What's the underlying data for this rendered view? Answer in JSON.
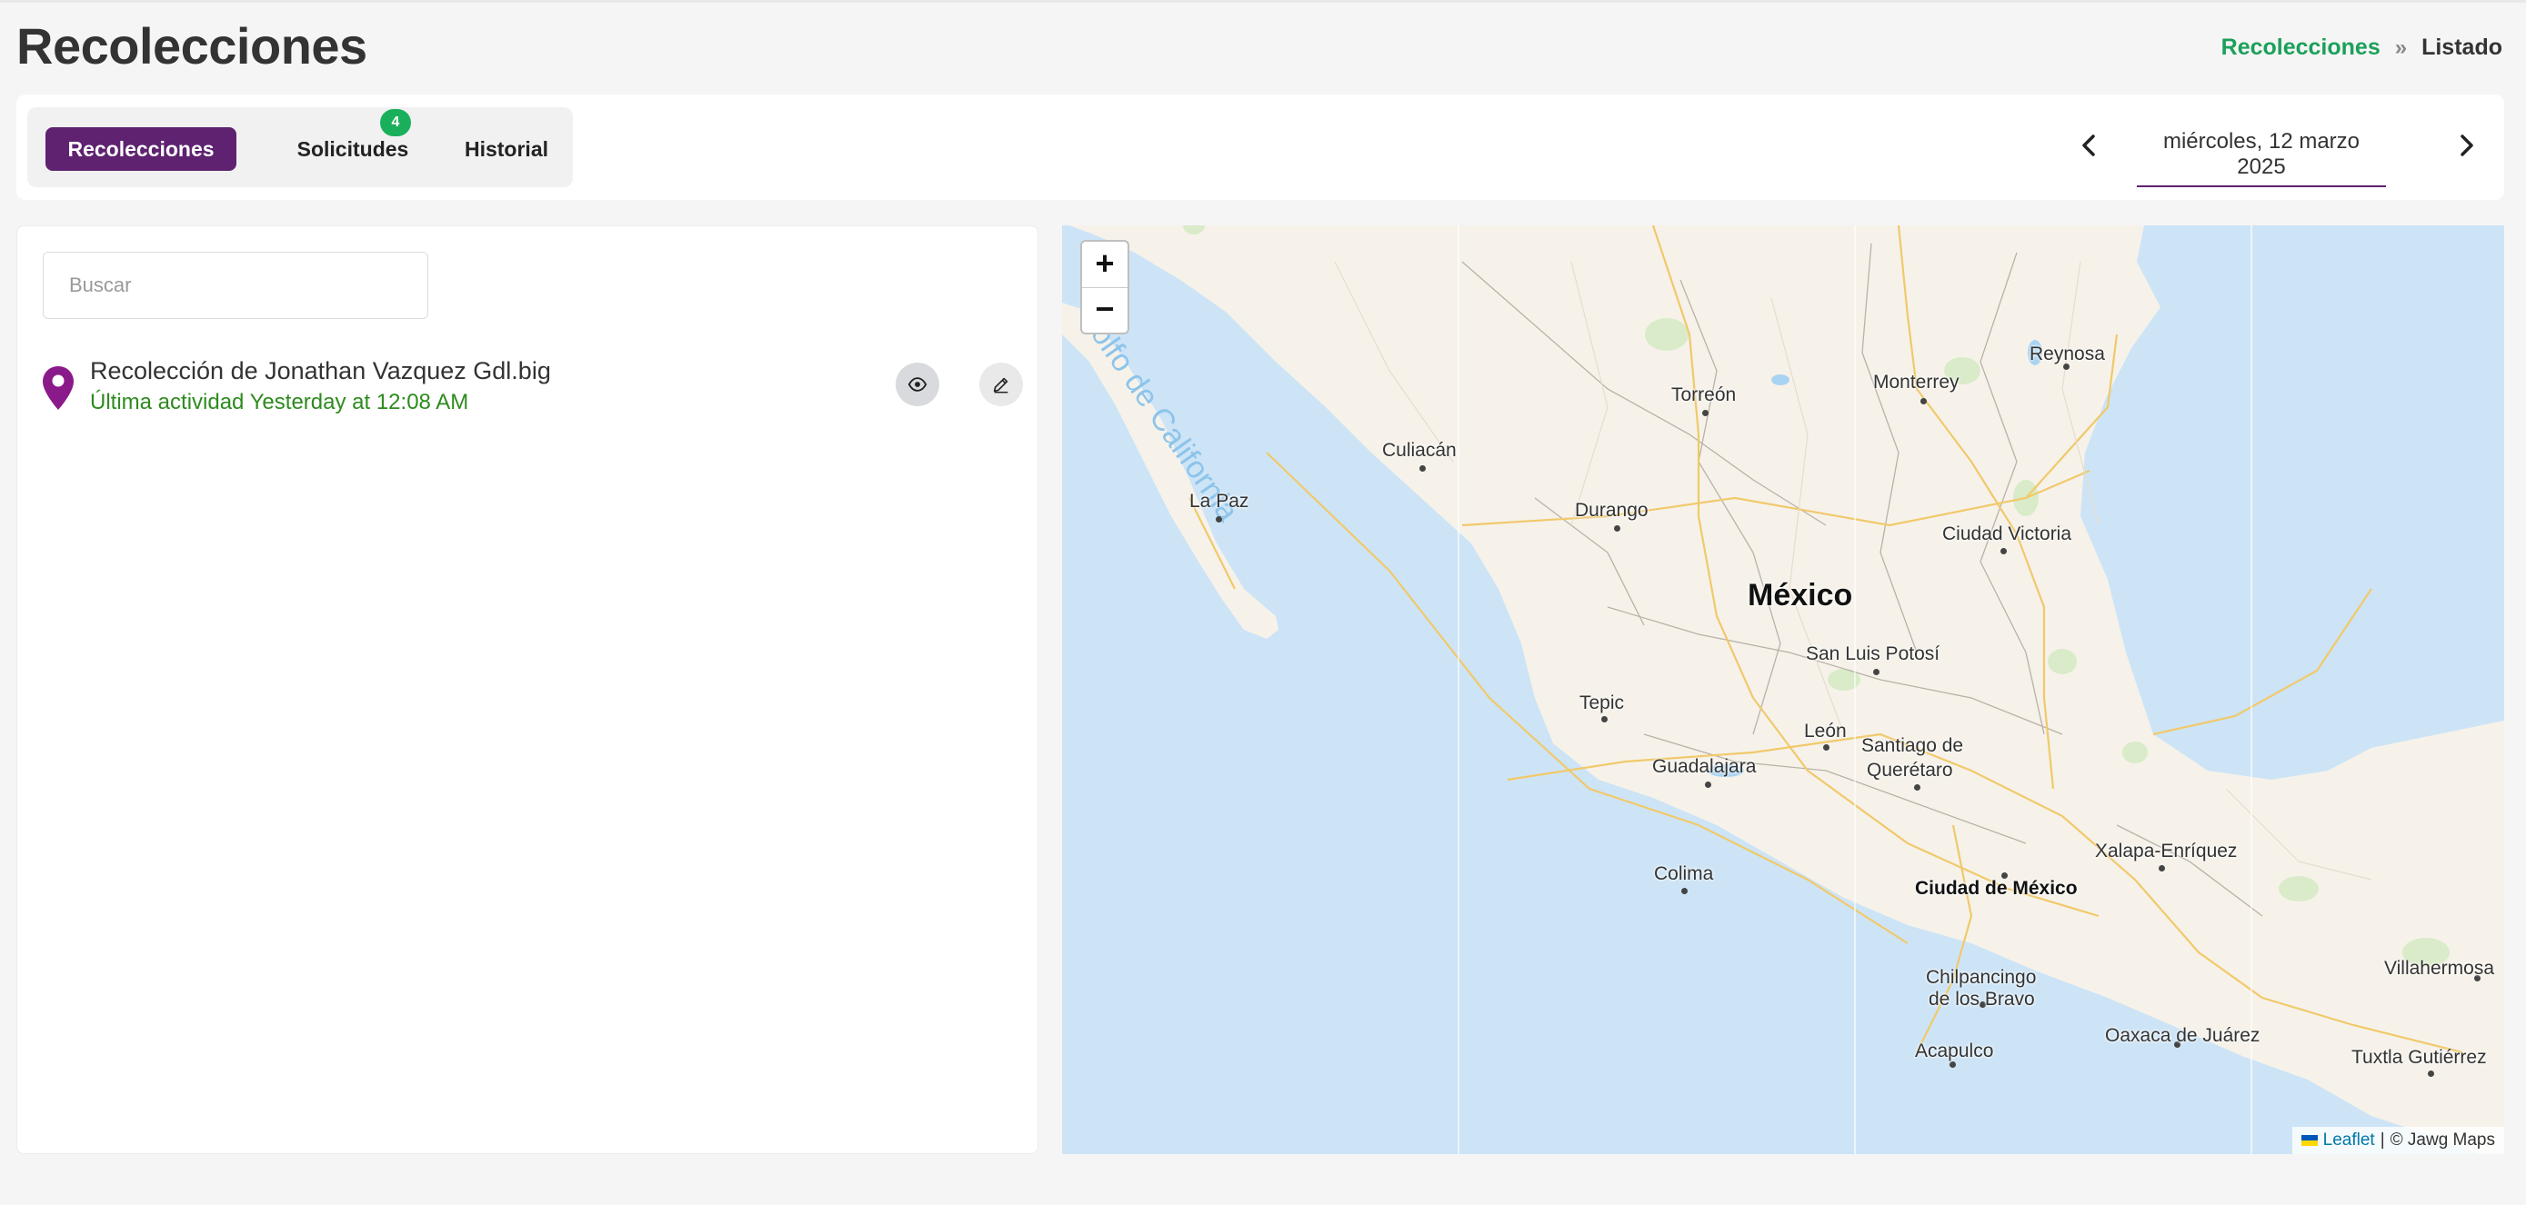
{
  "header": {
    "title": "Recolecciones",
    "breadcrumb": {
      "link": "Recolecciones",
      "separator": "»",
      "current": "Listado"
    }
  },
  "tabs": [
    {
      "label": "Recolecciones",
      "active": true
    },
    {
      "label": "Solicitudes",
      "badge": "4"
    },
    {
      "label": "Historial"
    }
  ],
  "date_nav": {
    "date": "miércoles, 12 marzo 2025"
  },
  "search": {
    "placeholder": "Buscar",
    "value": ""
  },
  "items": [
    {
      "title": "Recolección de Jonathan Vazquez Gdl.big",
      "subtitle": "Última actividad Yesterday at 12:08 AM"
    }
  ],
  "map": {
    "zoom_in": "+",
    "zoom_out": "−",
    "attribution": {
      "link": "Leaflet",
      "sep": "|",
      "text": "© Jawg Maps"
    },
    "sea_label": "Golfo de California",
    "country": "México",
    "places": [
      "Reynosa",
      "Monterrey",
      "Torreón",
      "Culiacán",
      "La Paz",
      "Durango",
      "Ciudad Victoria",
      "San Luis Potosí",
      "Tepic",
      "León",
      "Santiago de",
      "Querétaro",
      "Guadalajara",
      "Xalapa-Enríquez",
      "Colima",
      "Ciudad de México",
      "Villahermosa",
      "Chilpancingo",
      "de los Bravo",
      "Oaxaca de Juárez",
      "Acapulco",
      "Tuxtla Gutiérrez"
    ]
  },
  "colors": {
    "primary": "#5e2270",
    "accent_green": "#1ab05b",
    "pin": "#8a1a8a",
    "activity_text": "#2e8b1e"
  }
}
